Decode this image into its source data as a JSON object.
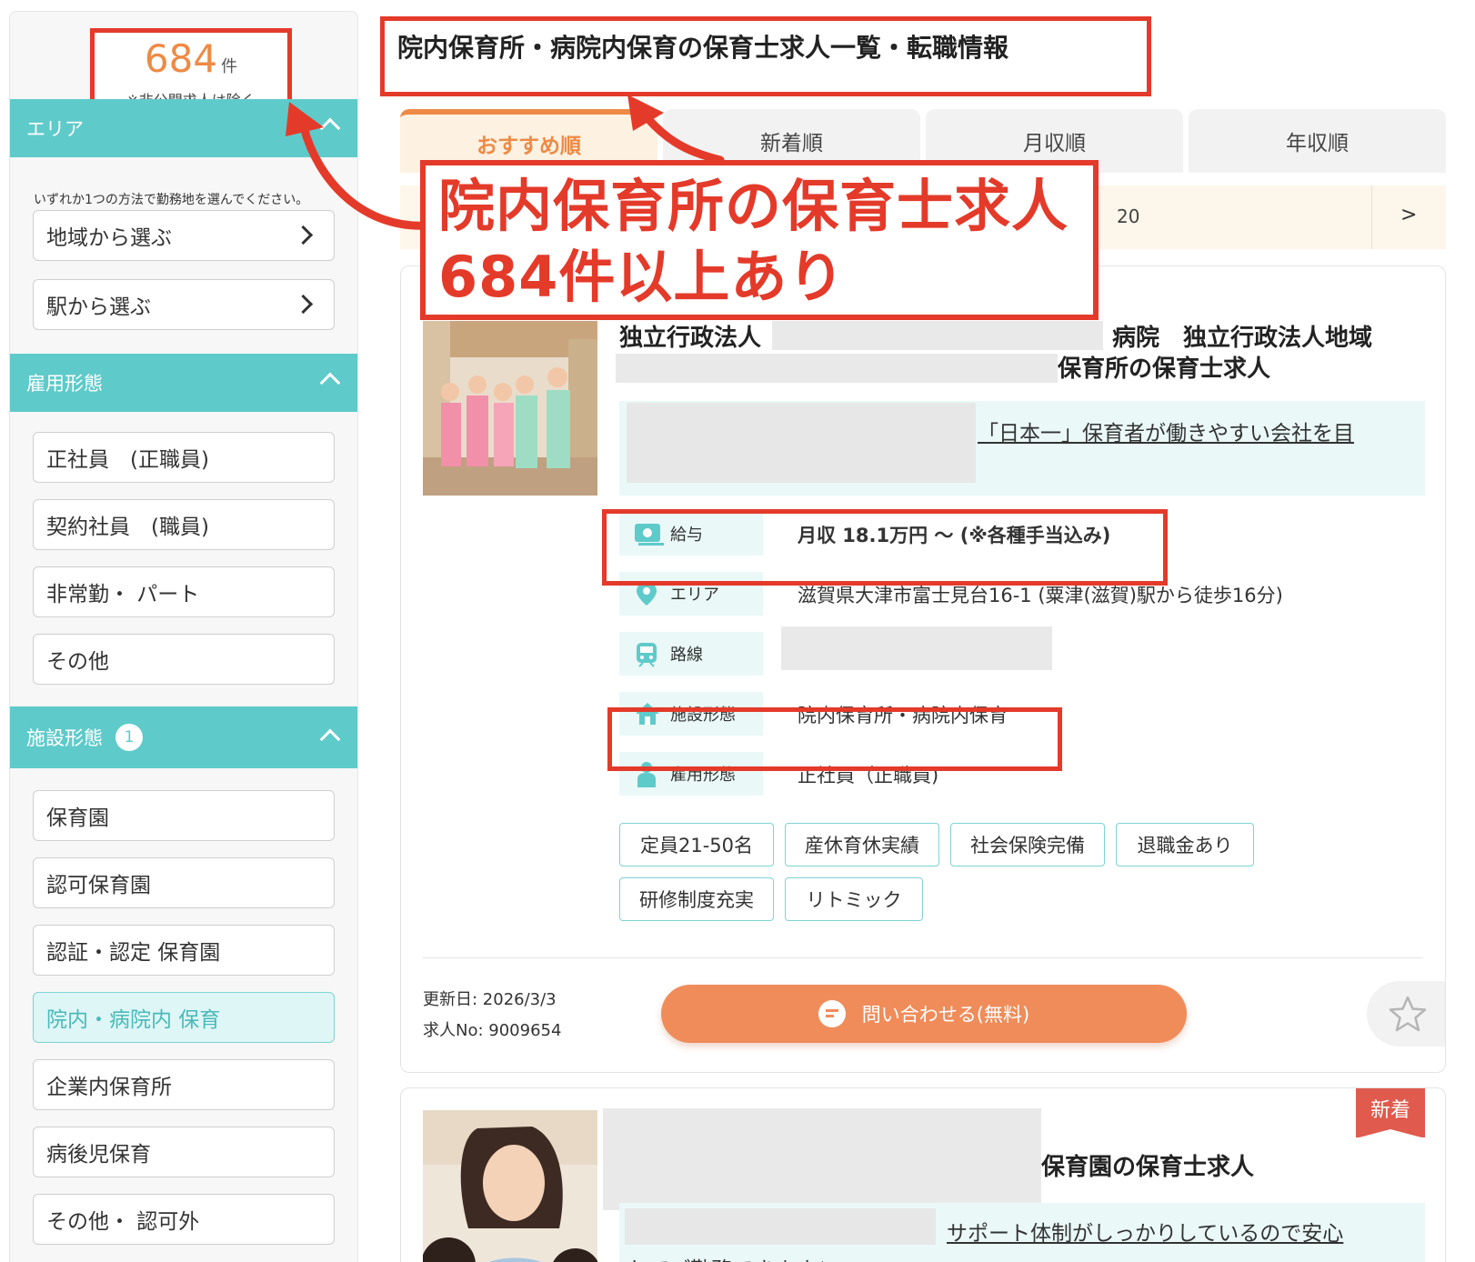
{
  "sidebar": {
    "count": "684",
    "count_unit": "件",
    "count_note": "※非公開求人は除く",
    "area": {
      "title": "エリア",
      "note": "いずれか1つの方法で勤務地を選んでください。",
      "options": [
        "地域から選ぶ",
        "駅から選ぶ"
      ]
    },
    "employment": {
      "title": "雇用形態",
      "options": [
        "正社員　(正職員)",
        "契約社員　(職員)",
        "非常勤・ パート",
        "その他"
      ]
    },
    "facility": {
      "title": "施設形態",
      "badge": "1",
      "options": [
        "保育園",
        "認可保育園",
        "認証・認定 保育園",
        "院内・病院内 保育",
        "企業内保育所",
        "病後児保育",
        "その他・ 認可外"
      ],
      "selected": "院内・病院内 保育"
    }
  },
  "main": {
    "title": "院内保育所・病院内保育の保育士求人一覧・転職情報",
    "tabs": [
      "おすすめ順",
      "新着順",
      "月収順",
      "年収順"
    ],
    "active_tab": "おすすめ順",
    "pager": {
      "number": "20",
      "next": ">"
    }
  },
  "annotation": {
    "line1": "院内保育所の保育士求人",
    "line2": "684件以上あり",
    "color": "#e43a2a"
  },
  "jobs": [
    {
      "title_part1": "独立行政法人",
      "title_part2": "病院　独立行政法人地域",
      "title_part3": "保育所の保育士求人",
      "catch": "「日本一」保育者が働きやすい会社を目",
      "salary_label": "給与",
      "salary": "月収 18.1万円 〜 (※各種手当込み)",
      "area_label": "エリア",
      "area": "滋賀県大津市富士見台16-1 (粟津(滋賀)駅から徒歩16分)",
      "line_label": "路線",
      "facility_label": "施設形態",
      "facility": "院内保育所・病院内保育",
      "employment_label": "雇用形態",
      "employment": "正社員（正職員)",
      "tags": [
        "定員21-50名",
        "産休育休実績",
        "社会保険完備",
        "退職金あり",
        "研修制度充実",
        "リトミック"
      ],
      "updated": "更新日: 2026/3/3",
      "job_no": "求人No: 9009654",
      "cta": "問い合わせる(無料)"
    },
    {
      "badge": "新着",
      "title": "保育園の保育士求人",
      "catch_line1": "サポート体制がしっかりしているので安心",
      "catch_line2": "してご勤務できます♪"
    }
  ],
  "colors": {
    "accent": "#ee8a45",
    "teal": "#5fcaca",
    "highlight": "#e43a2a"
  }
}
